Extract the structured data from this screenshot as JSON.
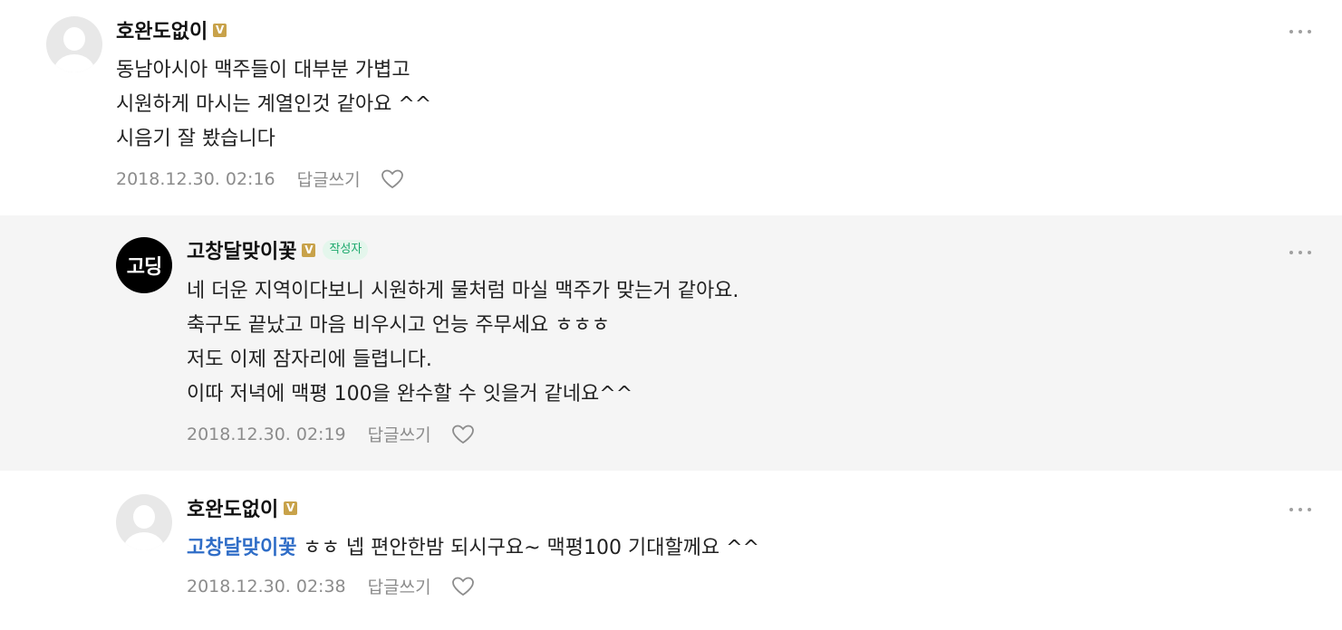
{
  "comments": [
    {
      "author": "호완도없이",
      "badge": "V",
      "lines": [
        "동남아시아 맥주들이 대부분 가볍고",
        "시원하게 마시는 계열인것 같아요 ^^",
        "시음기 잘 봤습니다"
      ],
      "timestamp": "2018.12.30. 02:16",
      "reply_label": "답글쓰기",
      "avatar_icon": "default-profile-icon"
    },
    {
      "author": "고창달맞이꽃",
      "badge": "V",
      "author_tag": "작성자",
      "avatar_logo": "고딩",
      "lines": [
        "네 더운 지역이다보니 시원하게 물처럼 마실 맥주가 맞는거 같아요.",
        "축구도 끝났고 마음 비우시고 언능 주무세요 ㅎㅎㅎ",
        "저도 이제 잠자리에 들렵니다.",
        "이따 저녁에 맥평 100을 완수할 수 잇을거 같네요^^"
      ],
      "timestamp": "2018.12.30. 02:19",
      "reply_label": "답글쓰기",
      "avatar_icon": "brand-logo-icon"
    },
    {
      "author": "호완도없이",
      "badge": "V",
      "mention": "고창달맞이꽃",
      "lines": [
        " ㅎㅎ 넵 편안한밤 되시구요~ 맥평100 기대할께요 ^^"
      ],
      "timestamp": "2018.12.30. 02:38",
      "reply_label": "답글쓰기",
      "avatar_icon": "default-profile-icon"
    }
  ],
  "colors": {
    "reply_background": "#f5f5f5",
    "mention": "#2f6dc7",
    "badge": "#c8a24a",
    "author_tag_text": "#1aa86b",
    "meta_text": "#8c8c8c"
  },
  "icons": [
    "more-options-icon",
    "heart-icon",
    "verified-badge-icon"
  ]
}
